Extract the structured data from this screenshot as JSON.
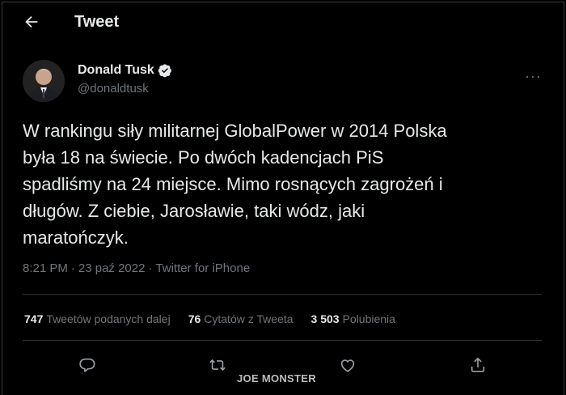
{
  "header": {
    "back_icon": "arrow-left-icon",
    "title": "Tweet"
  },
  "author": {
    "name": "Donald Tusk",
    "handle": "@donaldtusk",
    "verified_icon": "verified-badge-icon",
    "more_label": "···"
  },
  "tweet": {
    "text": "W rankingu siły militarnej GlobalPower w 2014 Polska\nbyła 18 na świecie. Po dwóch kadencjach PiS\nspadliśmy na 24 miejsce. Mimo rosnących zagrożeń i\ndługów. Z ciebie, Jarosławie, taki wódz, jaki\nmaratończyk.",
    "time": "8:21 PM",
    "date": "23 paź 2022",
    "source": "Twitter for iPhone",
    "separator": "·"
  },
  "stats": [
    {
      "value": "747",
      "label": "Tweetów podanych dalej"
    },
    {
      "value": "76",
      "label": "Cytatów z Tweeta"
    },
    {
      "value": "3 503",
      "label": "Polubienia"
    }
  ],
  "actions": [
    "reply-icon",
    "retweet-icon",
    "like-icon",
    "share-icon"
  ],
  "watermark": "JOE MONSTER",
  "colors": {
    "background": "#000000",
    "text": "#e7e9ea",
    "muted": "#71767b",
    "verified": "#1d9bf0"
  }
}
